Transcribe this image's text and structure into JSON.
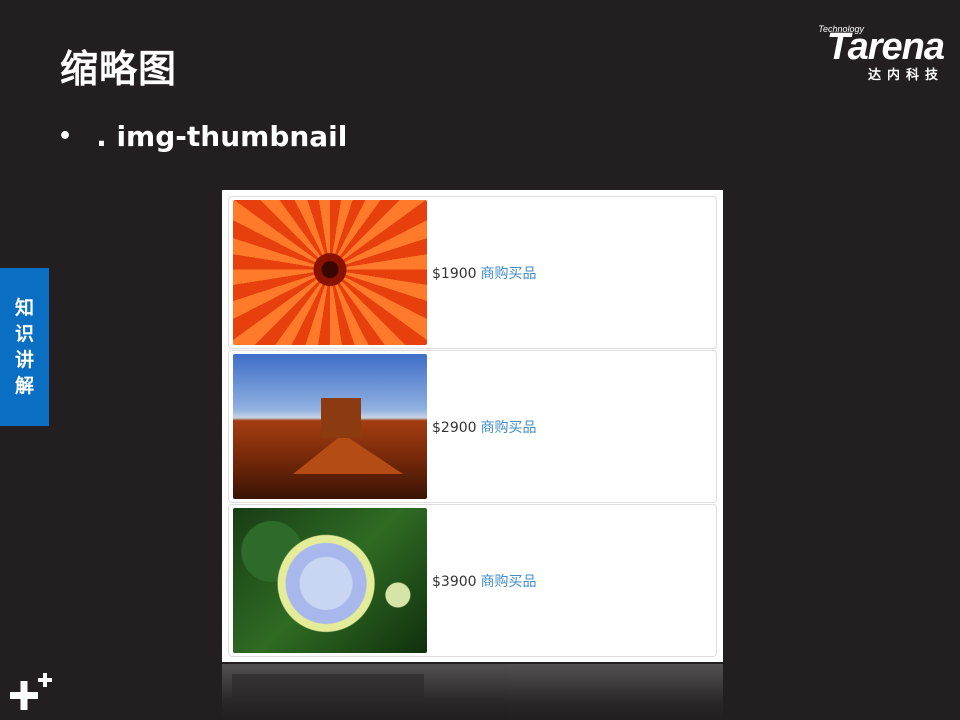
{
  "slide": {
    "title": "缩略图",
    "bullet": ". img-thumbnail",
    "side_tab": [
      "知",
      "识",
      "讲",
      "解"
    ]
  },
  "logo": {
    "technology": "Technology",
    "word": "Tarena",
    "cn": "达内科技"
  },
  "products": [
    {
      "image": "chrysanthemum",
      "price": "$1900",
      "link": "商购买品"
    },
    {
      "image": "desert",
      "price": "$2900",
      "link": "商购买品"
    },
    {
      "image": "hydrangea",
      "price": "$3900",
      "link": "商购买品"
    }
  ],
  "colors": {
    "background": "#231f20",
    "side_tab": "#0a6fc2",
    "link": "#428bca"
  }
}
